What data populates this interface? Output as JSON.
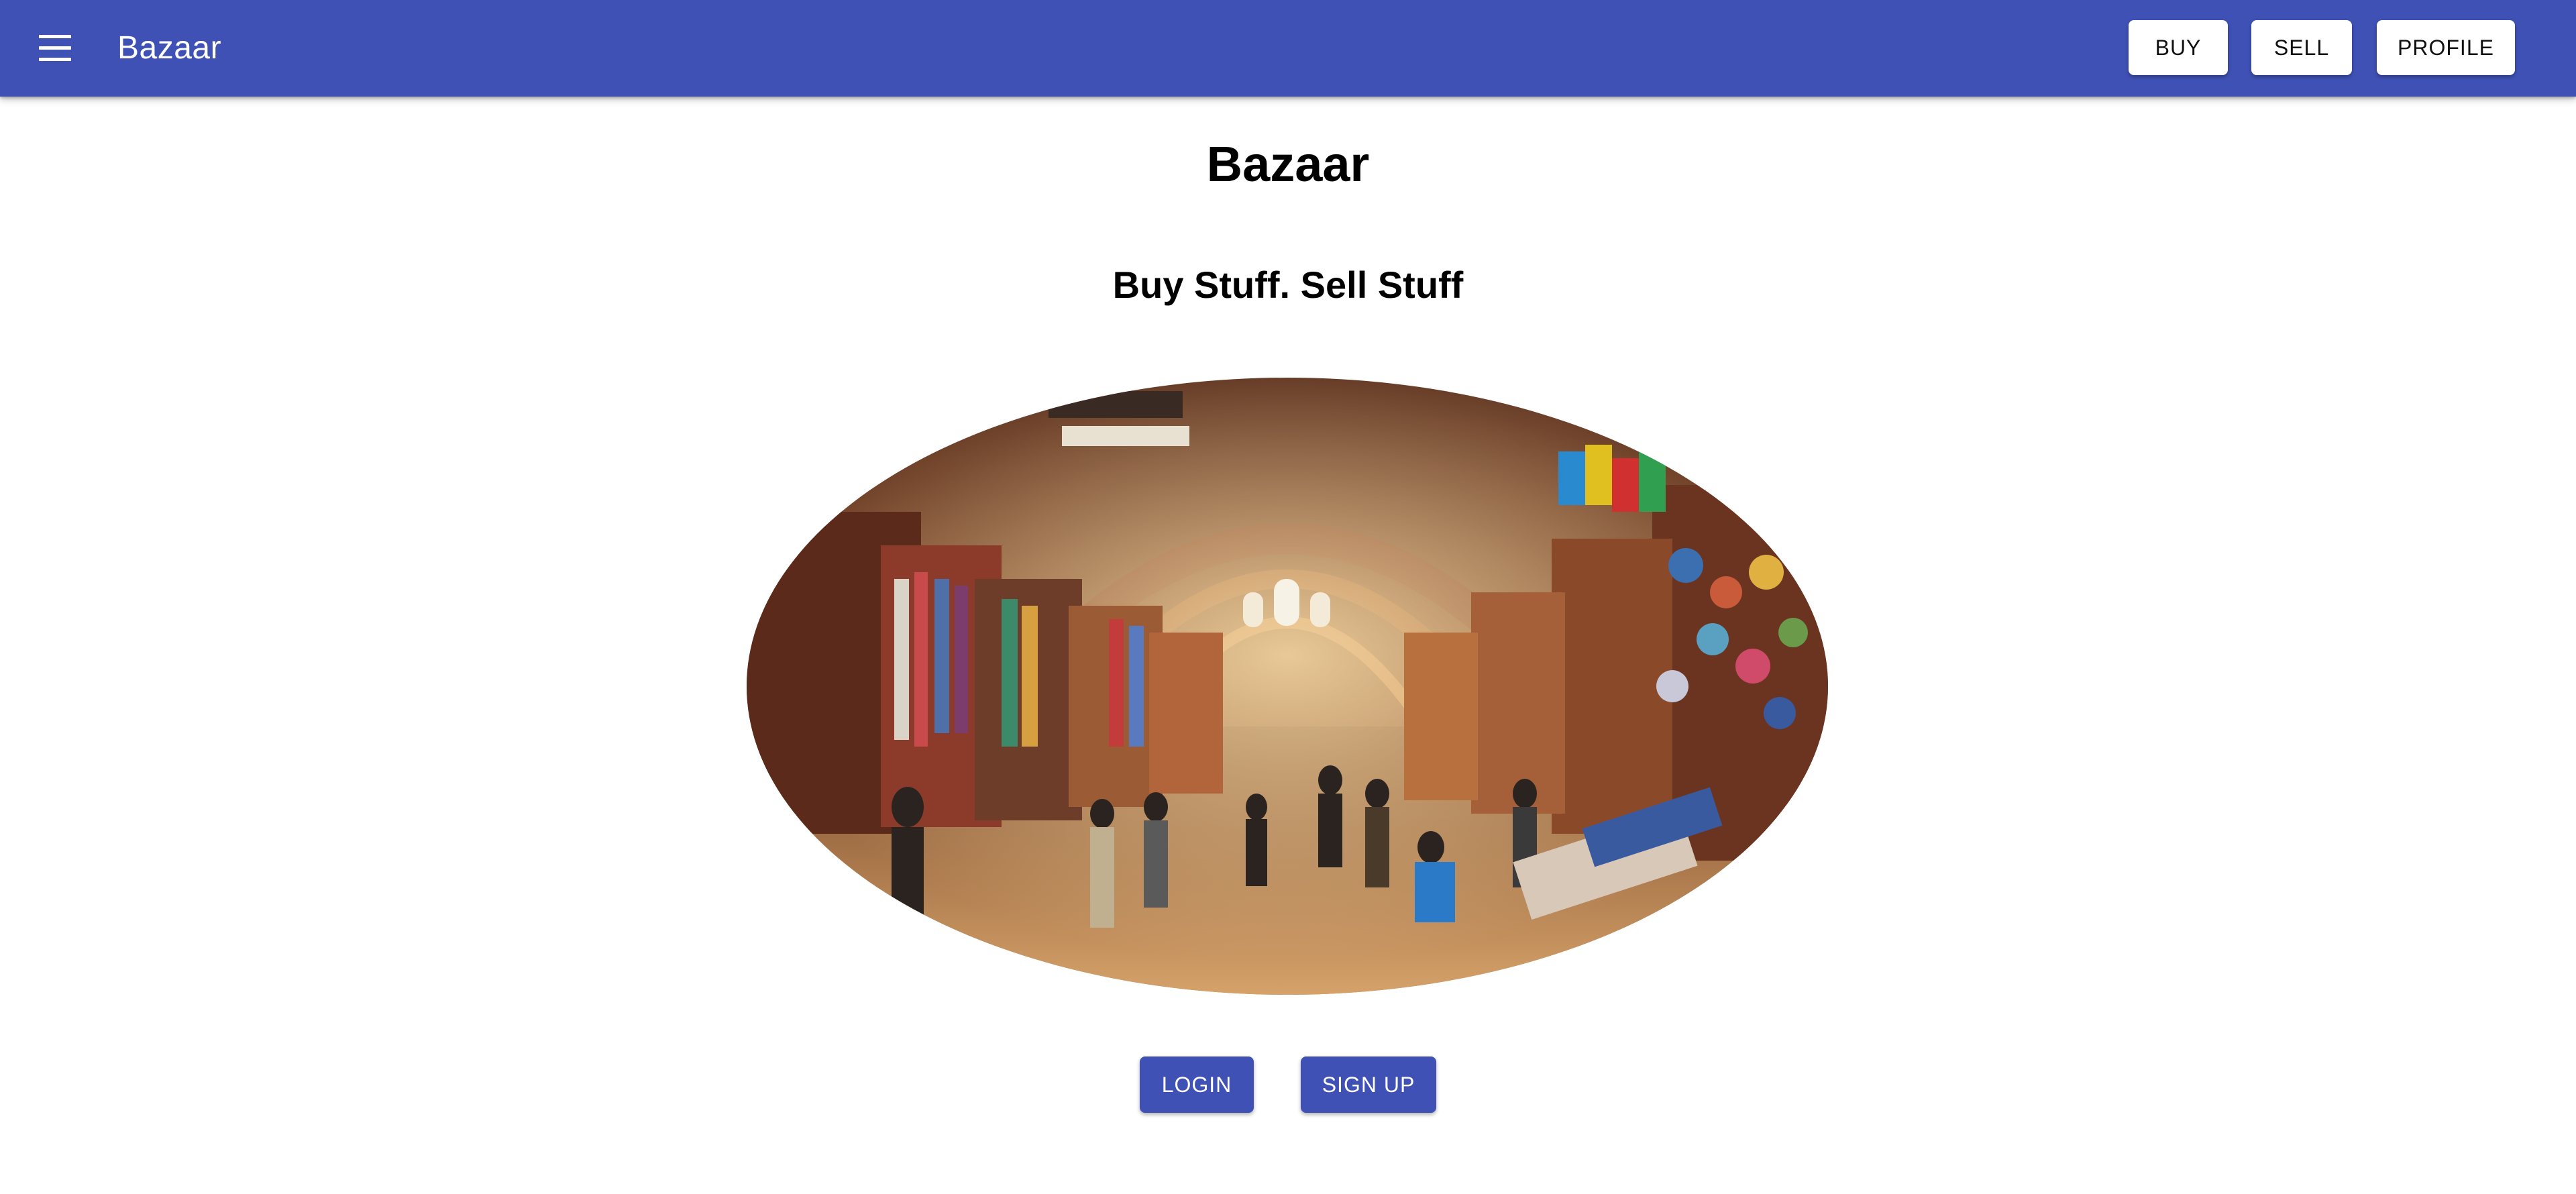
{
  "appbar": {
    "menu_icon": "menu-icon",
    "title": "Bazaar",
    "nav": [
      {
        "label": "BUY"
      },
      {
        "label": "SELL"
      },
      {
        "label": "PROFILE"
      }
    ]
  },
  "main": {
    "title": "Bazaar",
    "tagline": "Buy Stuff. Sell Stuff",
    "hero_alt": "Crowded covered bazaar market hall",
    "actions": {
      "login_label": "LOGIN",
      "signup_label": "SIGN UP"
    }
  },
  "colors": {
    "primary": "#3f51b5",
    "appbar_text": "#ffffff",
    "background": "#ffffff"
  }
}
